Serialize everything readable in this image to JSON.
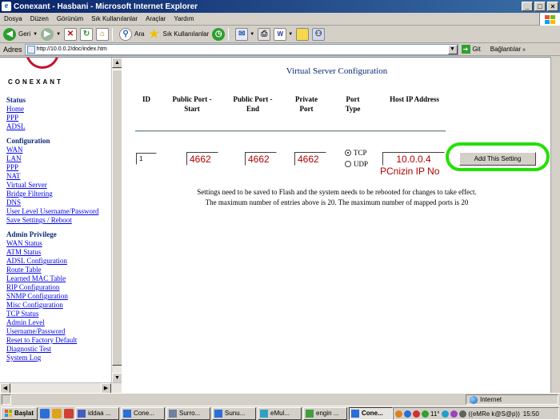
{
  "window": {
    "title": "Conexant - Hasbani - Microsoft Internet Explorer",
    "controls": [
      "_",
      "□",
      "×"
    ]
  },
  "menu": [
    "Dosya",
    "Düzen",
    "Görünüm",
    "Sık Kullanılanlar",
    "Araçlar",
    "Yardım"
  ],
  "toolbar": {
    "back_label": "Geri",
    "search_label": "Ara",
    "favorites_label": "Sık Kullanılanlar"
  },
  "address": {
    "label": "Adres",
    "url": "http://10.0.0.2/doc/index.htm",
    "go_label": "Git",
    "links_label": "Bağlantılar"
  },
  "sidebar": {
    "logo_text": "CONEXANT",
    "sections": [
      {
        "title": "Status",
        "items": [
          "Home",
          "PPP",
          "ADSL"
        ]
      },
      {
        "title": "Configuration",
        "items": [
          "WAN",
          "LAN",
          "PPP",
          "NAT",
          "Virtual Server",
          "Bridge Filtering",
          "DNS",
          "User Level Username/Password",
          "Save Settings / Reboot"
        ]
      },
      {
        "title": "Admin Privilege",
        "items": [
          "WAN Status",
          "ATM Status",
          "ADSL Configuration",
          "Route Table",
          "Learned MAC Table",
          "RIP Configuration",
          "SNMP Configuration",
          "Misc Configuration",
          "TCP Status",
          "Admin Level",
          "Username/Password",
          "Reset to Factory Default",
          "Diagnostic Test",
          "System Log"
        ]
      }
    ]
  },
  "main": {
    "title": "Virtual Server Configuration",
    "headers": {
      "id": "ID",
      "pub_start_1": "Public Port -",
      "pub_start_2": "Start",
      "pub_end_1": "Public Port -",
      "pub_end_2": "End",
      "private_1": "Private",
      "private_2": "Port",
      "type_1": "Port",
      "type_2": "Type",
      "host": "Host IP Address"
    },
    "row": {
      "id": "1",
      "pub_start": "4662",
      "pub_end": "4662",
      "private": "4662",
      "tcp_label": "TCP",
      "udp_label": "UDP",
      "host_ip": "10.0.0.4"
    },
    "add_button": "Add This Setting",
    "annotation": "PCnizin IP No",
    "note_1": "Settings need to be saved to Flash and the system needs to be rebooted for changes to take effect.",
    "note_2": "The maximum number of entries above is 20. The maximum number of mapped ports is 20"
  },
  "status": {
    "zone": "Internet"
  },
  "taskbar": {
    "start": "Başlat",
    "buttons": [
      "iddaa ...",
      "Cone...",
      "Surro...",
      "Sunu...",
      "eMul...",
      "engin ...",
      "Cone..."
    ],
    "tray_text": "11°",
    "user": "((eMRe k@S@p))",
    "clock": "15:50"
  },
  "colors": {
    "title_bar": "#0a246a",
    "nav_heading": "#0b2a7a",
    "link": "#0000ee",
    "port_value": "#b00000",
    "highlight_ring": "#22e000"
  }
}
